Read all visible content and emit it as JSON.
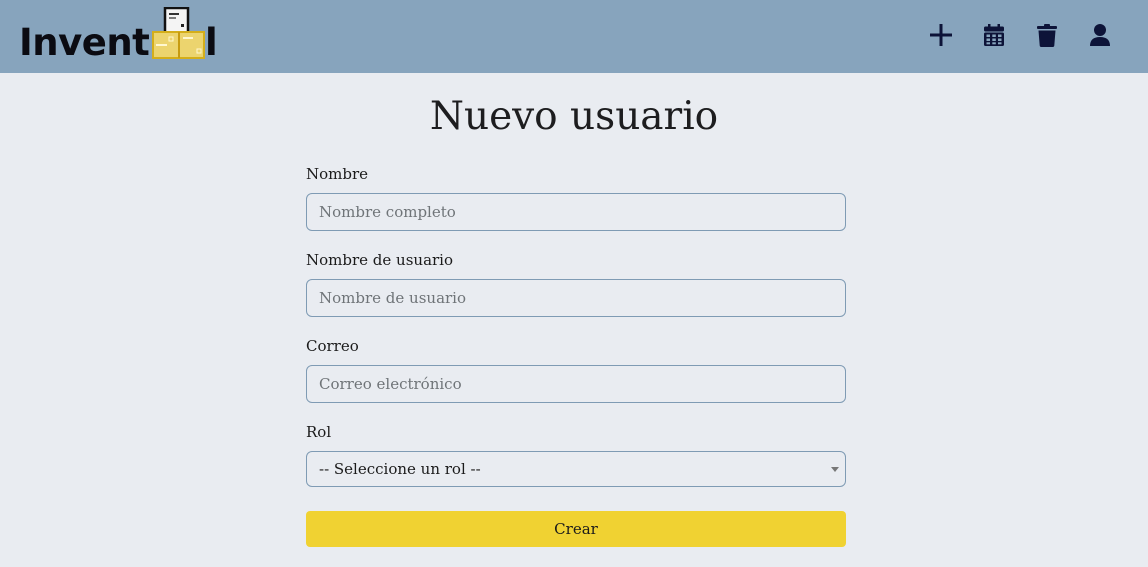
{
  "header": {
    "logo": {
      "text_left": "Invent",
      "text_right": "l"
    },
    "nav": [
      {
        "name": "add",
        "icon": "plus-icon"
      },
      {
        "name": "calendar",
        "icon": "calendar-icon"
      },
      {
        "name": "trash",
        "icon": "trash-icon"
      },
      {
        "name": "user",
        "icon": "user-icon"
      }
    ]
  },
  "page": {
    "title": "Nuevo usuario"
  },
  "form": {
    "name": {
      "label": "Nombre",
      "placeholder": "Nombre completo",
      "value": ""
    },
    "username": {
      "label": "Nombre de usuario",
      "placeholder": "Nombre de usuario",
      "value": ""
    },
    "email": {
      "label": "Correo",
      "placeholder": "Correo electrónico",
      "value": ""
    },
    "role": {
      "label": "Rol",
      "selected": "-- Seleccione un rol --"
    },
    "submit_label": "Crear"
  },
  "colors": {
    "header_bg": "#87a4bd",
    "page_bg": "#e9ecf1",
    "accent": "#f0d232",
    "icon": "#0d1338"
  }
}
